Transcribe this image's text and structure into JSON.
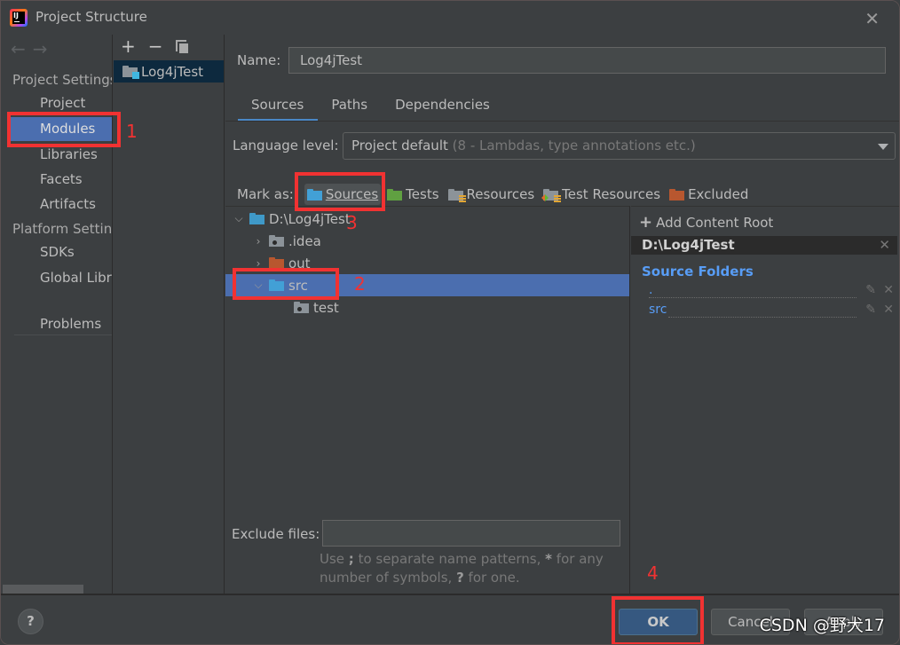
{
  "window": {
    "title": "Project Structure"
  },
  "nav": {
    "back_icon": "arrow-left-icon",
    "forward_icon": "arrow-right-icon",
    "project_settings_header": "Project Settings",
    "project_settings_items": [
      {
        "label": "Project",
        "selected": false
      },
      {
        "label": "Modules",
        "selected": true
      },
      {
        "label": "Libraries",
        "selected": false
      },
      {
        "label": "Facets",
        "selected": false
      },
      {
        "label": "Artifacts",
        "selected": false
      }
    ],
    "platform_settings_header": "Platform Settings",
    "platform_settings_items": [
      {
        "label": "SDKs"
      },
      {
        "label": "Global Libraries"
      }
    ],
    "problems_label": "Problems"
  },
  "modules": {
    "toolbar": {
      "add": "+",
      "remove": "−"
    },
    "items": [
      {
        "label": "Log4jTest",
        "selected": true
      }
    ]
  },
  "main": {
    "name_label": "Name:",
    "name_value": "Log4jTest",
    "tabs": [
      {
        "label": "Sources",
        "active": true
      },
      {
        "label": "Paths",
        "active": false
      },
      {
        "label": "Dependencies",
        "active": false
      }
    ],
    "language_level_label": "Language level:",
    "language_level_value": "Project default",
    "language_level_detail": "(8 - Lambdas, type annotations etc.)",
    "mark_as_label": "Mark as:",
    "mark_as_buttons": [
      {
        "label": "Sources",
        "selected": true,
        "color": "#42a0d6"
      },
      {
        "label": "Tests",
        "selected": false,
        "color": "#60a041"
      },
      {
        "label": "Resources",
        "selected": false,
        "color": "#8c9399"
      },
      {
        "label": "Test Resources",
        "selected": false,
        "color": "#8c9399"
      },
      {
        "label": "Excluded",
        "selected": false,
        "color": "#b8572f"
      }
    ],
    "tree": [
      {
        "label": "D:\\Log4jTest",
        "expanded": true,
        "selected": false
      },
      {
        "label": ".idea",
        "expanded": false,
        "selected": false
      },
      {
        "label": "out",
        "expanded": false,
        "selected": false
      },
      {
        "label": "src",
        "expanded": true,
        "selected": true
      },
      {
        "label": "test",
        "selected": false
      }
    ],
    "exclude_files_label": "Exclude files:",
    "exclude_files_value": "",
    "hint_parts": [
      "Use ",
      ";",
      " to separate name patterns, ",
      "*",
      " for any number of symbols, ",
      "?",
      " for one."
    ]
  },
  "content_root": {
    "add_label": "Add Content Root",
    "root_path": "D:\\Log4jTest",
    "source_folders_title": "Source Folders",
    "source_folders": [
      {
        "name": "."
      },
      {
        "name": "src"
      }
    ]
  },
  "footer": {
    "help": "?",
    "ok": "OK",
    "cancel": "Cancel",
    "apply": "Apply"
  },
  "annotations": {
    "step1": "1",
    "step2": "2",
    "step3": "3",
    "step4": "4",
    "color": "#f13232"
  },
  "watermark": "CSDN @野犬17"
}
